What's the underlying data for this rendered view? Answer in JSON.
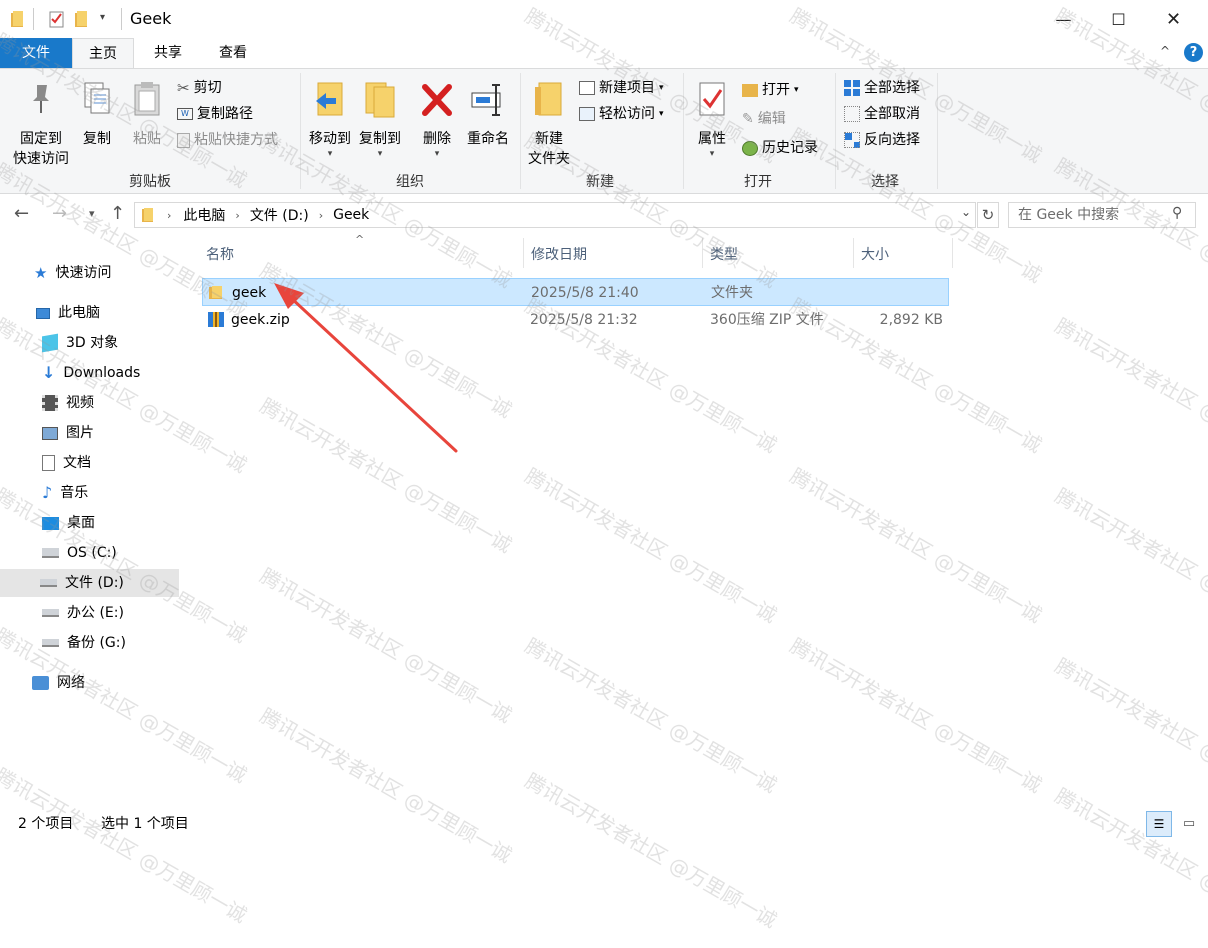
{
  "window": {
    "title": "Geek"
  },
  "tabs": [
    {
      "label": "文件"
    },
    {
      "label": "主页"
    },
    {
      "label": "共享"
    },
    {
      "label": "查看"
    }
  ],
  "ribbon": {
    "clipboard": {
      "pin": "固定到\n快速访问",
      "pin_l1": "固定到",
      "pin_l2": "快速访问",
      "copy": "复制",
      "paste": "粘贴",
      "cut": "剪切",
      "copy_path": "复制路径",
      "paste_shortcut": "粘贴快捷方式",
      "label": "剪贴板"
    },
    "organize": {
      "move_to": "移动到",
      "copy_to": "复制到",
      "delete": "删除",
      "rename": "重命名",
      "label": "组织"
    },
    "new": {
      "new_folder_l1": "新建",
      "new_folder_l2": "文件夹",
      "new_item": "新建项目",
      "easy_access": "轻松访问",
      "label": "新建"
    },
    "open": {
      "properties": "属性",
      "open": "打开",
      "edit": "编辑",
      "history": "历史记录",
      "label": "打开"
    },
    "select": {
      "select_all": "全部选择",
      "select_none": "全部取消",
      "invert": "反向选择",
      "label": "选择"
    }
  },
  "address": {
    "crumbs": [
      "此电脑",
      "文件 (D:)",
      "Geek"
    ],
    "search_placeholder": "在 Geek 中搜索"
  },
  "sidebar": {
    "items": [
      {
        "label": "快速访问"
      },
      {
        "label": "此电脑"
      },
      {
        "label": "3D 对象"
      },
      {
        "label": "Downloads"
      },
      {
        "label": "视频"
      },
      {
        "label": "图片"
      },
      {
        "label": "文档"
      },
      {
        "label": "音乐"
      },
      {
        "label": "桌面"
      },
      {
        "label": "OS (C:)"
      },
      {
        "label": "文件 (D:)"
      },
      {
        "label": "办公 (E:)"
      },
      {
        "label": "备份 (G:)"
      },
      {
        "label": "网络"
      }
    ]
  },
  "columns": [
    "名称",
    "修改日期",
    "类型",
    "大小"
  ],
  "files": [
    {
      "name": "geek",
      "date": "2025/5/8 21:40",
      "type": "文件夹",
      "size": ""
    },
    {
      "name": "geek.zip",
      "date": "2025/5/8 21:32",
      "type": "360压缩 ZIP 文件",
      "size": "2,892 KB"
    }
  ],
  "status": {
    "count": "2 个项目",
    "selected": "选中 1 个项目"
  },
  "watermark": "腾讯云开发者社区 @万里顾一诚",
  "colors": {
    "accent": "#1979ca",
    "selection": "#cce8ff",
    "arrow": "#e8453c"
  }
}
